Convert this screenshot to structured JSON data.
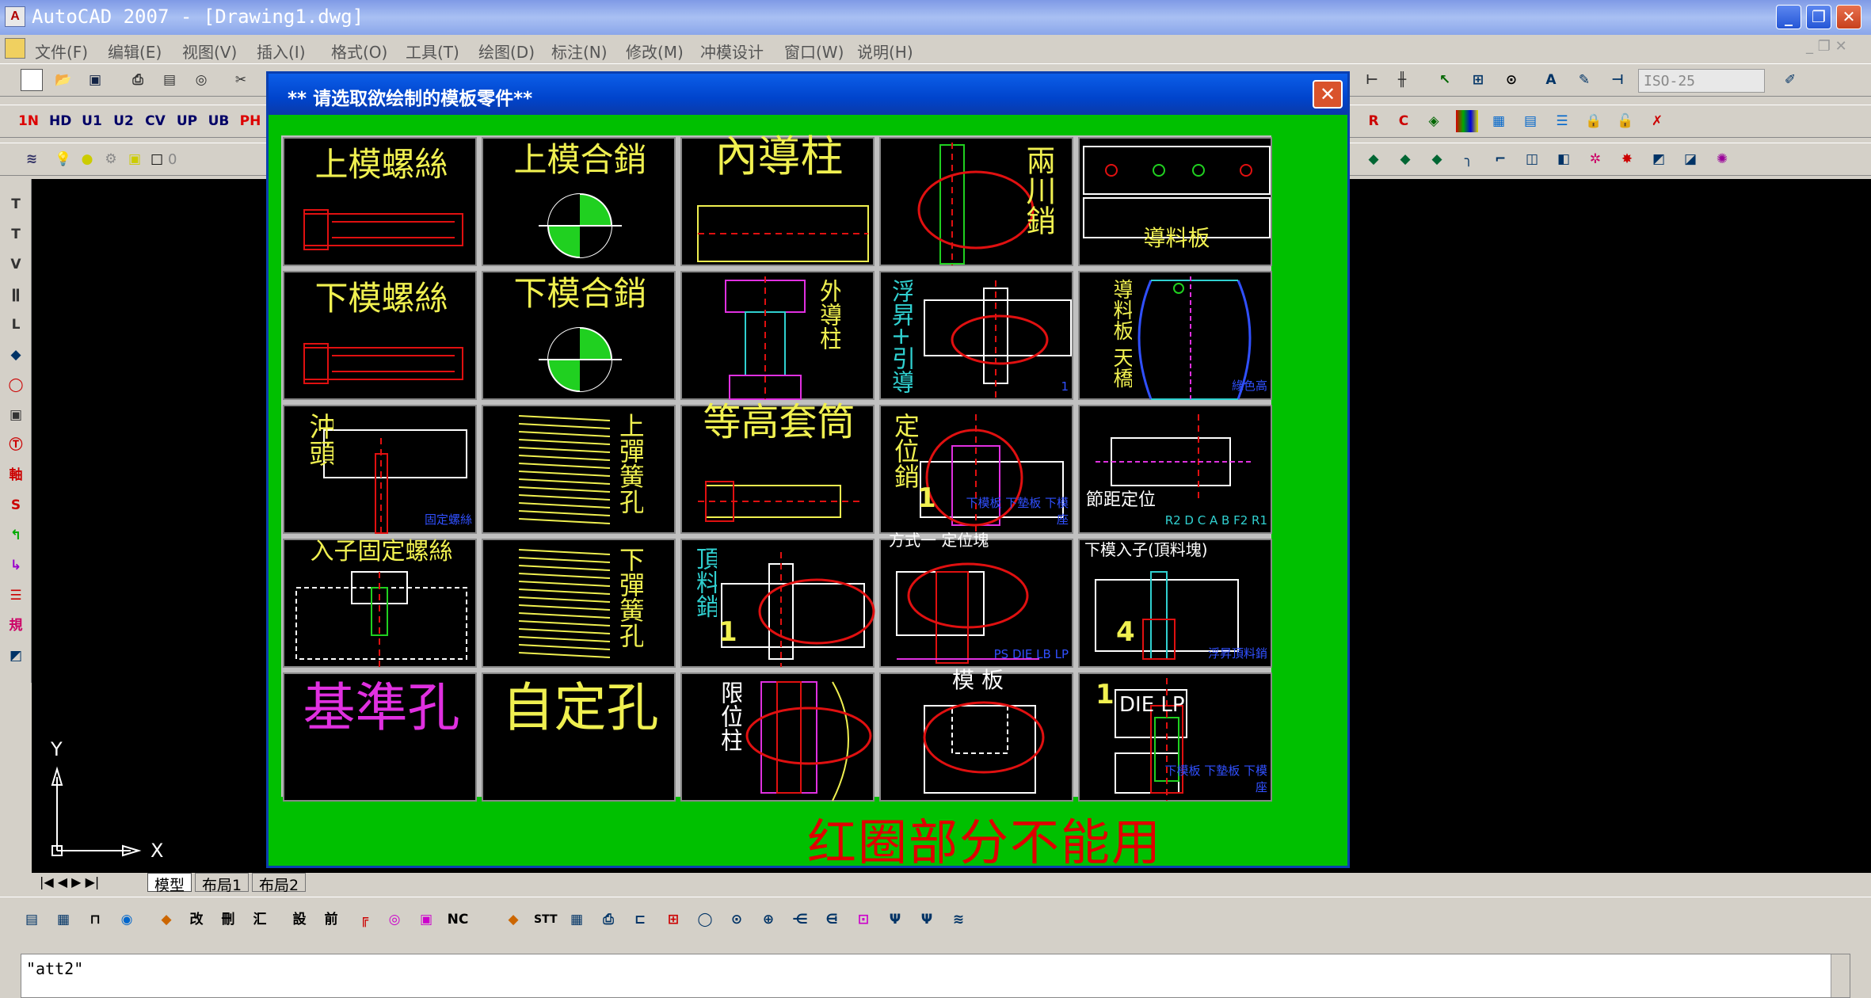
{
  "window": {
    "title": "AutoCAD 2007 - [Drawing1.dwg]",
    "app_icon": "A",
    "minimize": "_",
    "restore": "❐",
    "close": "✕"
  },
  "menu": [
    "文件(F)",
    "编辑(E)",
    "视图(V)",
    "插入(I)",
    "格式(O)",
    "工具(T)",
    "绘图(D)",
    "标注(N)",
    "修改(M)",
    "冲模设计",
    "窗口(W)",
    "说明(H)"
  ],
  "toolbar": {
    "dimstyle": "ISO-25",
    "layer_value": "0",
    "row2": [
      "1N",
      "HD",
      "U1",
      "U2",
      "CV",
      "UP",
      "UB",
      "PH"
    ]
  },
  "dialog": {
    "title": "** 请选取欲绘制的模板零件**",
    "close": "✕",
    "warning": "红圈部分不能用",
    "cells": [
      {
        "label": "上模螺絲"
      },
      {
        "label": "上模合銷"
      },
      {
        "label": "內導柱"
      },
      {
        "label": "兩川銷"
      },
      {
        "label": "導料板"
      },
      {
        "label": "下模螺絲"
      },
      {
        "label": "下模合銷"
      },
      {
        "label": "外導柱"
      },
      {
        "label": "浮昇+引導",
        "sub": "1"
      },
      {
        "label": "導料板 天橋",
        "sub": "綠色高"
      },
      {
        "label": "沖頭",
        "sub": "固定螺絲"
      },
      {
        "label": "上彈簧孔"
      },
      {
        "label": "等高套筒"
      },
      {
        "label": "定位銷",
        "sub": "下模板 下墊板 下模座",
        "num": "1"
      },
      {
        "label": "節距定位",
        "sub": "R2 D C A B F2 R1"
      },
      {
        "label": "入子固定螺絲"
      },
      {
        "label": "下彈簧孔"
      },
      {
        "label": "頂料銷",
        "num": "1"
      },
      {
        "label": "方式一 定位塊",
        "sub": "PS DIE LB LP"
      },
      {
        "label": "下模入子(頂料塊)",
        "sub": "浮昇頂料銷",
        "num": "4"
      },
      {
        "label": "基準孔"
      },
      {
        "label": "自定孔"
      },
      {
        "label": "限位柱"
      },
      {
        "label": "模 板"
      },
      {
        "label": "DIE LP",
        "sub": "下模板 下墊板 下模座",
        "num": "1"
      }
    ]
  },
  "ucs": {
    "x": "X",
    "y": "Y"
  },
  "tabs": [
    "模型",
    "布局1",
    "布局2"
  ],
  "command_line": "\"att2\"",
  "bottom_toolbar": [
    "改",
    "刪",
    "汇",
    "設",
    "前",
    "NC",
    "STT"
  ]
}
